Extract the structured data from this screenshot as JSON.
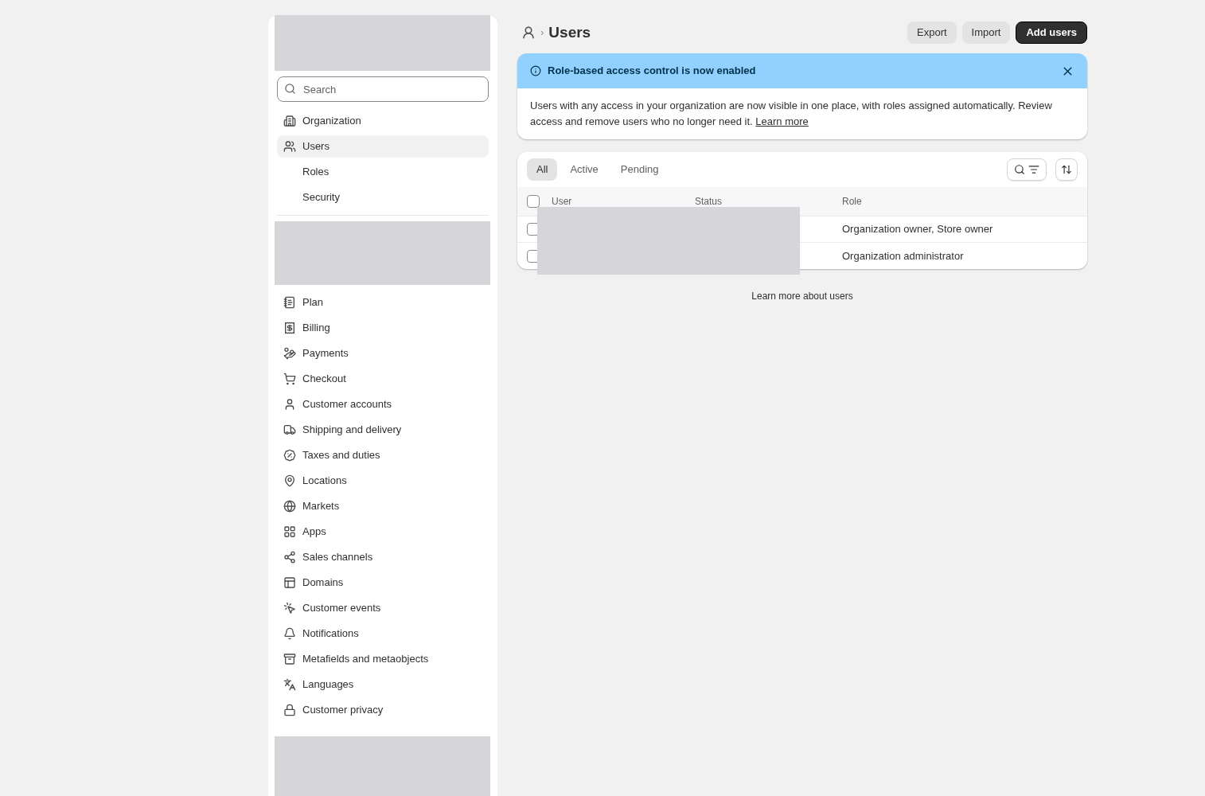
{
  "sidebar": {
    "search": {
      "placeholder": "Search"
    },
    "items": [
      {
        "label": "Organization",
        "selected": false
      },
      {
        "label": "Users",
        "selected": true,
        "children": [
          {
            "label": "Roles",
            "selected": false
          },
          {
            "label": "Security",
            "selected": false
          }
        ]
      }
    ],
    "settings": [
      {
        "label": "Plan",
        "selected": false
      },
      {
        "label": "Billing",
        "selected": false
      },
      {
        "label": "Payments",
        "selected": false
      },
      {
        "label": "Checkout",
        "selected": false
      },
      {
        "label": "Customer accounts",
        "selected": false
      },
      {
        "label": "Shipping and delivery",
        "selected": false
      },
      {
        "label": "Taxes and duties",
        "selected": false
      },
      {
        "label": "Locations",
        "selected": false
      },
      {
        "label": "Markets",
        "selected": false
      },
      {
        "label": "Apps",
        "selected": false
      },
      {
        "label": "Sales channels",
        "selected": false
      },
      {
        "label": "Domains",
        "selected": false
      },
      {
        "label": "Customer events",
        "selected": false
      },
      {
        "label": "Notifications",
        "selected": false
      },
      {
        "label": "Metafields and metaobjects",
        "selected": false
      },
      {
        "label": "Languages",
        "selected": false
      },
      {
        "label": "Customer privacy",
        "selected": false
      }
    ]
  },
  "header": {
    "breadcrumb_separator": "›",
    "title": "Users",
    "buttons": [
      {
        "label": "Export",
        "kind": "secondary"
      },
      {
        "label": "Import",
        "kind": "secondary"
      },
      {
        "label": "Add users",
        "kind": "primary"
      }
    ]
  },
  "banner": {
    "title": "Role-based access control is now enabled",
    "text": "Users with any access in your organization are now visible in one place, with roles assigned automatically. Review access and remove users who no longer need it.",
    "link": "Learn more"
  },
  "table": {
    "tabs": [
      {
        "label": "All",
        "selected": true
      },
      {
        "label": "Active",
        "selected": false
      },
      {
        "label": "Pending",
        "selected": false
      }
    ],
    "columns": [
      "User",
      "Status",
      "Role"
    ],
    "header_checked": false,
    "rows": [
      {
        "checked": false,
        "role": "Organization owner, Store owner"
      },
      {
        "checked": false,
        "role": "Organization administrator"
      }
    ]
  },
  "footer_link": "Learn more about users"
}
